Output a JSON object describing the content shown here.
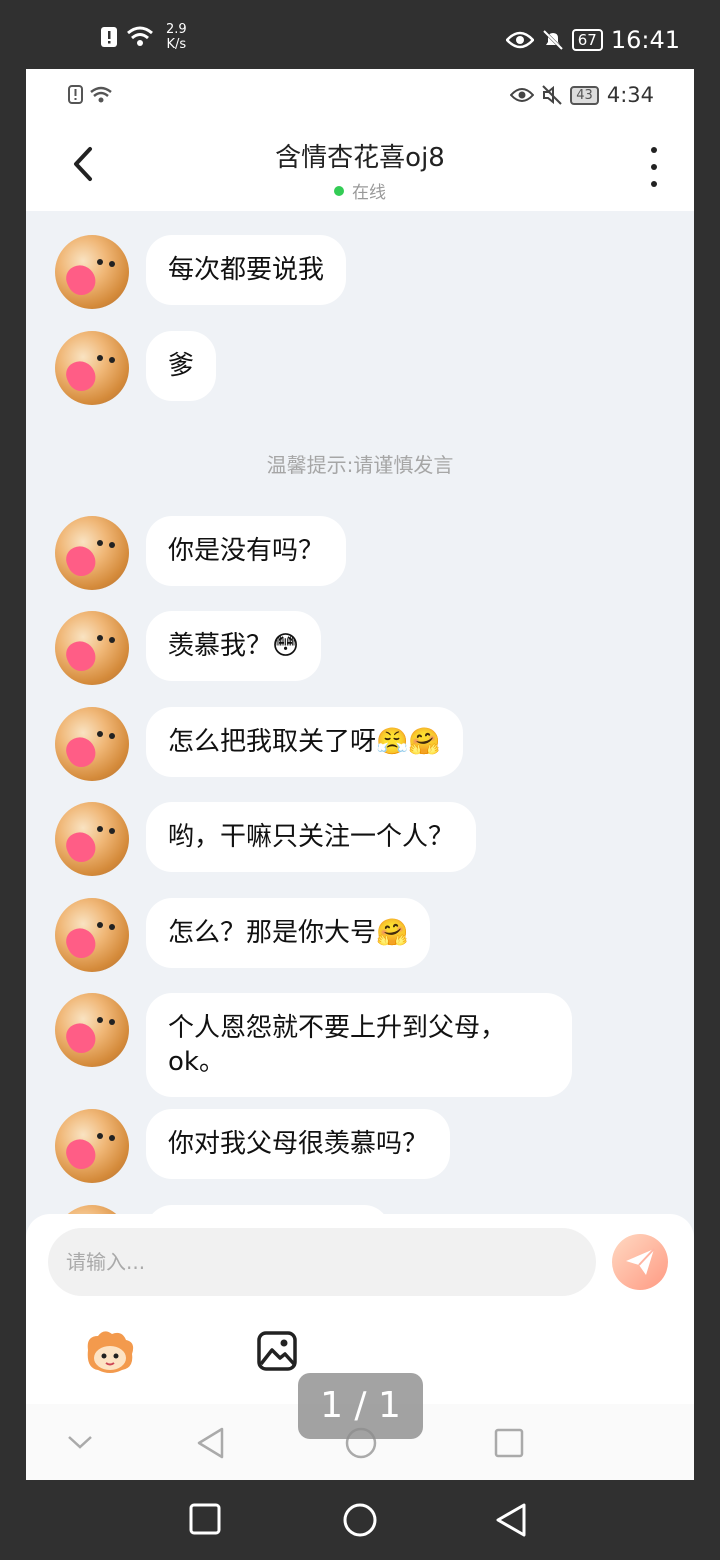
{
  "outer_status": {
    "net_speed_value": "2.9",
    "net_speed_unit": "K/s",
    "battery": "67",
    "time": "16:41"
  },
  "inner_status": {
    "battery": "43",
    "time": "4:34"
  },
  "header": {
    "title": "含情杏花喜oj8",
    "status": "在线"
  },
  "messages": [
    {
      "text": "每次都要说我"
    },
    {
      "text": "爹"
    },
    {
      "text": "你是没有吗？"
    },
    {
      "text": " 羡慕我？😳"
    },
    {
      "text": "怎么把我取关了呀😤🤗"
    },
    {
      "text": "哟，干嘛只关注一个人？"
    },
    {
      "text": "怎么？那是你大号🤗"
    },
    {
      "text": "个人恩怨就不要上升到父母，ok。"
    },
    {
      "text": "你对我父母很羡慕吗？"
    }
  ],
  "tip": "温馨提示:请谨慎发言",
  "input": {
    "placeholder": "请输入..."
  },
  "page_indicator": "1 / 1",
  "icons": [
    "back-arrow-icon",
    "more-icon",
    "send-icon",
    "emoji-avatar-icon",
    "image-icon",
    "collapse-icon",
    "nav-back-icon",
    "nav-home-icon",
    "nav-recent-icon"
  ],
  "colors": {
    "online": "#33cc55",
    "send": "#ff9a83",
    "chat_bg": "#eff2f6"
  }
}
